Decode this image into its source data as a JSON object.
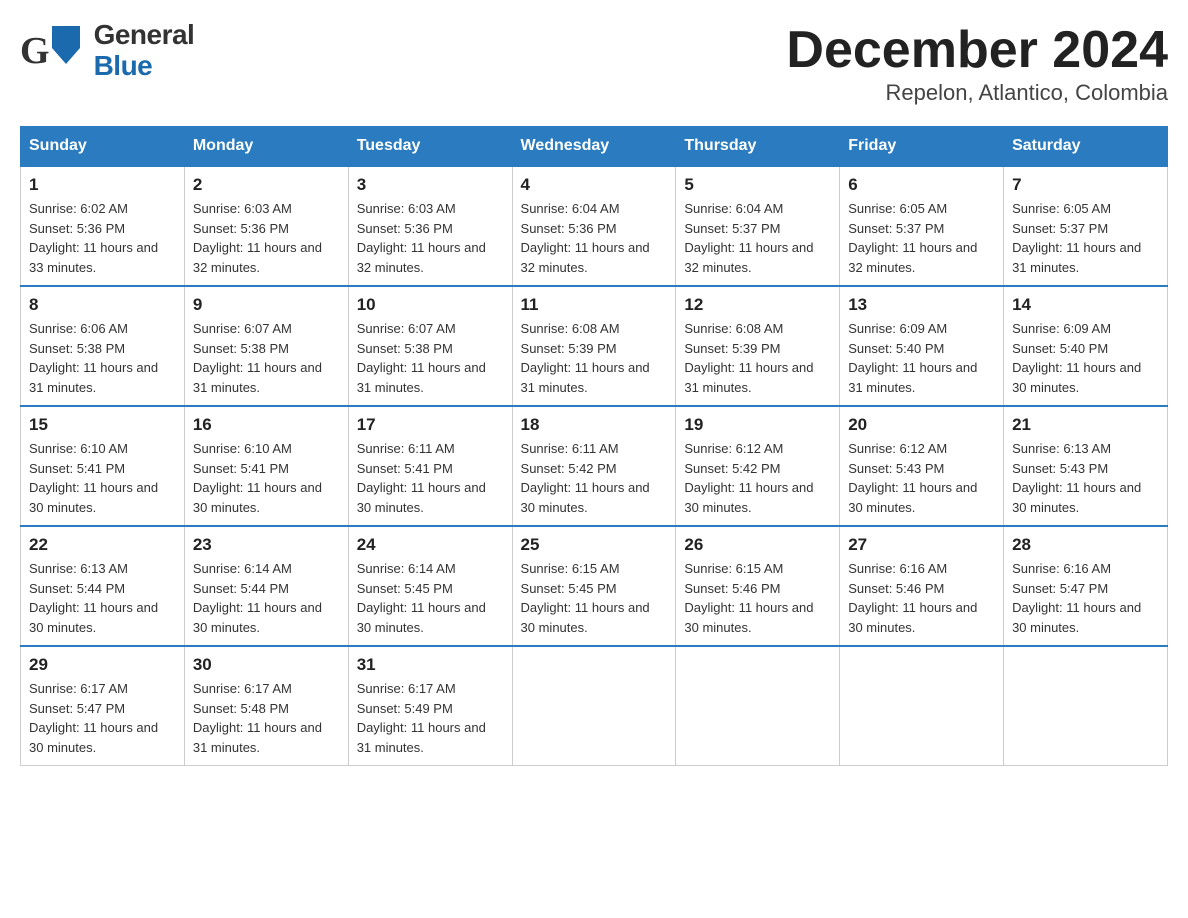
{
  "header": {
    "logo": {
      "general": "General",
      "blue": "Blue"
    },
    "title": "December 2024",
    "subtitle": "Repelon, Atlantico, Colombia"
  },
  "calendar": {
    "headers": [
      "Sunday",
      "Monday",
      "Tuesday",
      "Wednesday",
      "Thursday",
      "Friday",
      "Saturday"
    ],
    "weeks": [
      [
        {
          "day": "1",
          "sunrise": "6:02 AM",
          "sunset": "5:36 PM",
          "daylight": "11 hours and 33 minutes."
        },
        {
          "day": "2",
          "sunrise": "6:03 AM",
          "sunset": "5:36 PM",
          "daylight": "11 hours and 32 minutes."
        },
        {
          "day": "3",
          "sunrise": "6:03 AM",
          "sunset": "5:36 PM",
          "daylight": "11 hours and 32 minutes."
        },
        {
          "day": "4",
          "sunrise": "6:04 AM",
          "sunset": "5:36 PM",
          "daylight": "11 hours and 32 minutes."
        },
        {
          "day": "5",
          "sunrise": "6:04 AM",
          "sunset": "5:37 PM",
          "daylight": "11 hours and 32 minutes."
        },
        {
          "day": "6",
          "sunrise": "6:05 AM",
          "sunset": "5:37 PM",
          "daylight": "11 hours and 32 minutes."
        },
        {
          "day": "7",
          "sunrise": "6:05 AM",
          "sunset": "5:37 PM",
          "daylight": "11 hours and 31 minutes."
        }
      ],
      [
        {
          "day": "8",
          "sunrise": "6:06 AM",
          "sunset": "5:38 PM",
          "daylight": "11 hours and 31 minutes."
        },
        {
          "day": "9",
          "sunrise": "6:07 AM",
          "sunset": "5:38 PM",
          "daylight": "11 hours and 31 minutes."
        },
        {
          "day": "10",
          "sunrise": "6:07 AM",
          "sunset": "5:38 PM",
          "daylight": "11 hours and 31 minutes."
        },
        {
          "day": "11",
          "sunrise": "6:08 AM",
          "sunset": "5:39 PM",
          "daylight": "11 hours and 31 minutes."
        },
        {
          "day": "12",
          "sunrise": "6:08 AM",
          "sunset": "5:39 PM",
          "daylight": "11 hours and 31 minutes."
        },
        {
          "day": "13",
          "sunrise": "6:09 AM",
          "sunset": "5:40 PM",
          "daylight": "11 hours and 31 minutes."
        },
        {
          "day": "14",
          "sunrise": "6:09 AM",
          "sunset": "5:40 PM",
          "daylight": "11 hours and 30 minutes."
        }
      ],
      [
        {
          "day": "15",
          "sunrise": "6:10 AM",
          "sunset": "5:41 PM",
          "daylight": "11 hours and 30 minutes."
        },
        {
          "day": "16",
          "sunrise": "6:10 AM",
          "sunset": "5:41 PM",
          "daylight": "11 hours and 30 minutes."
        },
        {
          "day": "17",
          "sunrise": "6:11 AM",
          "sunset": "5:41 PM",
          "daylight": "11 hours and 30 minutes."
        },
        {
          "day": "18",
          "sunrise": "6:11 AM",
          "sunset": "5:42 PM",
          "daylight": "11 hours and 30 minutes."
        },
        {
          "day": "19",
          "sunrise": "6:12 AM",
          "sunset": "5:42 PM",
          "daylight": "11 hours and 30 minutes."
        },
        {
          "day": "20",
          "sunrise": "6:12 AM",
          "sunset": "5:43 PM",
          "daylight": "11 hours and 30 minutes."
        },
        {
          "day": "21",
          "sunrise": "6:13 AM",
          "sunset": "5:43 PM",
          "daylight": "11 hours and 30 minutes."
        }
      ],
      [
        {
          "day": "22",
          "sunrise": "6:13 AM",
          "sunset": "5:44 PM",
          "daylight": "11 hours and 30 minutes."
        },
        {
          "day": "23",
          "sunrise": "6:14 AM",
          "sunset": "5:44 PM",
          "daylight": "11 hours and 30 minutes."
        },
        {
          "day": "24",
          "sunrise": "6:14 AM",
          "sunset": "5:45 PM",
          "daylight": "11 hours and 30 minutes."
        },
        {
          "day": "25",
          "sunrise": "6:15 AM",
          "sunset": "5:45 PM",
          "daylight": "11 hours and 30 minutes."
        },
        {
          "day": "26",
          "sunrise": "6:15 AM",
          "sunset": "5:46 PM",
          "daylight": "11 hours and 30 minutes."
        },
        {
          "day": "27",
          "sunrise": "6:16 AM",
          "sunset": "5:46 PM",
          "daylight": "11 hours and 30 minutes."
        },
        {
          "day": "28",
          "sunrise": "6:16 AM",
          "sunset": "5:47 PM",
          "daylight": "11 hours and 30 minutes."
        }
      ],
      [
        {
          "day": "29",
          "sunrise": "6:17 AM",
          "sunset": "5:47 PM",
          "daylight": "11 hours and 30 minutes."
        },
        {
          "day": "30",
          "sunrise": "6:17 AM",
          "sunset": "5:48 PM",
          "daylight": "11 hours and 31 minutes."
        },
        {
          "day": "31",
          "sunrise": "6:17 AM",
          "sunset": "5:49 PM",
          "daylight": "11 hours and 31 minutes."
        },
        null,
        null,
        null,
        null
      ]
    ]
  }
}
